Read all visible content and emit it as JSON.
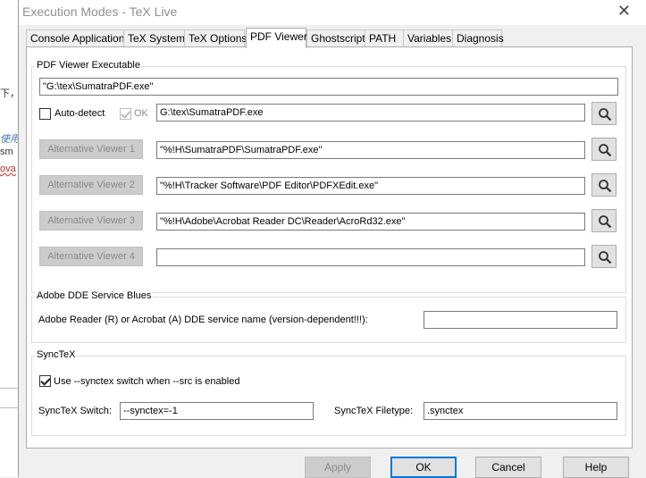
{
  "window": {
    "title": "Execution Modes - TeX Live",
    "close_glyph": "✕"
  },
  "background_fragments": [
    "下，",
    "使用",
    "sm",
    "ova"
  ],
  "tabs": [
    {
      "label": "Console Applications"
    },
    {
      "label": "TeX System"
    },
    {
      "label": "TeX Options"
    },
    {
      "label": "PDF Viewer"
    },
    {
      "label": "Ghostscript"
    },
    {
      "label": "PATH"
    },
    {
      "label": "Variables"
    },
    {
      "label": "Diagnosis"
    }
  ],
  "active_tab": "PDF Viewer",
  "pdf_viewer": {
    "group_title": "PDF Viewer Executable",
    "executable": "\"G:\\tex\\SumatraPDF.exe\"",
    "auto_detect_label": "Auto-detect",
    "auto_detect_checked": false,
    "ok_label": "OK",
    "ok_checked": true,
    "detected_path": "G:\\tex\\SumatraPDF.exe",
    "alternatives": [
      {
        "label": "Alternative Viewer 1",
        "path": "\"%!H\\SumatraPDF\\SumatraPDF.exe\""
      },
      {
        "label": "Alternative Viewer 2",
        "path": "\"%!H\\Tracker Software\\PDF Editor\\PDFXEdit.exe\""
      },
      {
        "label": "Alternative Viewer 3",
        "path": "\"%!H\\Adobe\\Acrobat Reader DC\\Reader\\AcroRd32.exe\""
      },
      {
        "label": "Alternative Viewer 4",
        "path": ""
      }
    ],
    "browse_icon": "magnifier-icon"
  },
  "adobe_dde": {
    "group_title": "Adobe DDE Service Blues",
    "label": "Adobe Reader (R) or Acrobat (A) DDE service name  (version-dependent!!!):",
    "value": ""
  },
  "synctex": {
    "group_title": "SyncTeX",
    "checkbox_label": "Use --synctex switch when --src is enabled",
    "checkbox_checked": true,
    "switch_label": "SyncTeX Switch:",
    "switch_value": "--synctex=-1",
    "filetype_label": "SyncTeX Filetype:",
    "filetype_value": ".synctex"
  },
  "buttons": {
    "apply": "Apply",
    "ok": "OK",
    "cancel": "Cancel",
    "help": "Help"
  },
  "colors": {
    "accent": "#0078d7",
    "disabled_button": "#cccccc"
  }
}
